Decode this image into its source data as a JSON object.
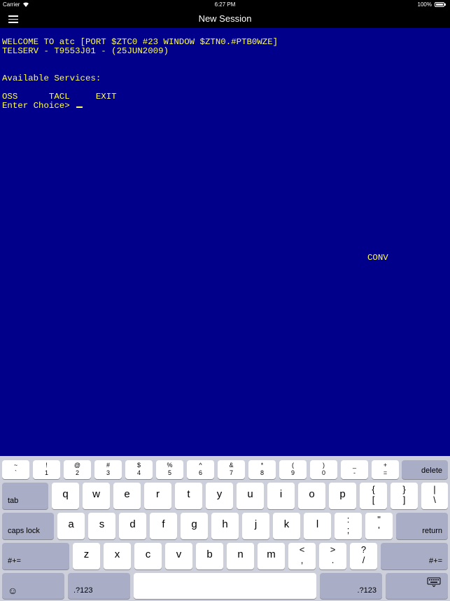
{
  "status_bar": {
    "carrier": "Carrier",
    "time": "6:27 PM",
    "battery": "100%"
  },
  "nav": {
    "title": "New Session"
  },
  "terminal": {
    "lines": [
      "WELCOME TO atc [PORT $ZTC0 #23 WINDOW $ZTN0.#PTB0WZE]",
      "TELSERV - T9553J01 - (25JUN2009)",
      "",
      "",
      "Available Services:",
      "",
      "OSS      TACL     EXIT",
      "Enter Choice> "
    ],
    "status_text": "CONV",
    "colors": {
      "background": "#00008b",
      "text": "#ffff55"
    }
  },
  "keyboard": {
    "number_row": [
      {
        "top": "~",
        "bottom": "`"
      },
      {
        "top": "!",
        "bottom": "1"
      },
      {
        "top": "@",
        "bottom": "2"
      },
      {
        "top": "#",
        "bottom": "3"
      },
      {
        "top": "$",
        "bottom": "4"
      },
      {
        "top": "%",
        "bottom": "5"
      },
      {
        "top": "^",
        "bottom": "6"
      },
      {
        "top": "&",
        "bottom": "7"
      },
      {
        "top": "*",
        "bottom": "8"
      },
      {
        "top": "(",
        "bottom": "9"
      },
      {
        "top": ")",
        "bottom": "0"
      },
      {
        "top": "_",
        "bottom": "-"
      },
      {
        "top": "+",
        "bottom": "="
      }
    ],
    "delete": "delete",
    "tab": "tab",
    "row_q": [
      "q",
      "w",
      "e",
      "r",
      "t",
      "y",
      "u",
      "i",
      "o",
      "p"
    ],
    "row_q_syms": [
      {
        "top": "{",
        "bottom": "["
      },
      {
        "top": "}",
        "bottom": "]"
      },
      {
        "top": "|",
        "bottom": "\\"
      }
    ],
    "caps_lock": "caps lock",
    "row_a": [
      "a",
      "s",
      "d",
      "f",
      "g",
      "h",
      "j",
      "k",
      "l"
    ],
    "row_a_syms": [
      {
        "top": ":",
        "bottom": ";"
      },
      {
        "top": "\"",
        "bottom": "'"
      }
    ],
    "return": "return",
    "shift_left": "#+=",
    "row_z": [
      "z",
      "x",
      "c",
      "v",
      "b",
      "n",
      "m"
    ],
    "row_z_syms": [
      {
        "top": "<",
        "bottom": ","
      },
      {
        "top": ">",
        "bottom": "."
      },
      {
        "top": "?",
        "bottom": "/"
      }
    ],
    "shift_right": "#+=",
    "emoji": "☺",
    "numbers_left": ".?123",
    "numbers_right": ".?123"
  }
}
